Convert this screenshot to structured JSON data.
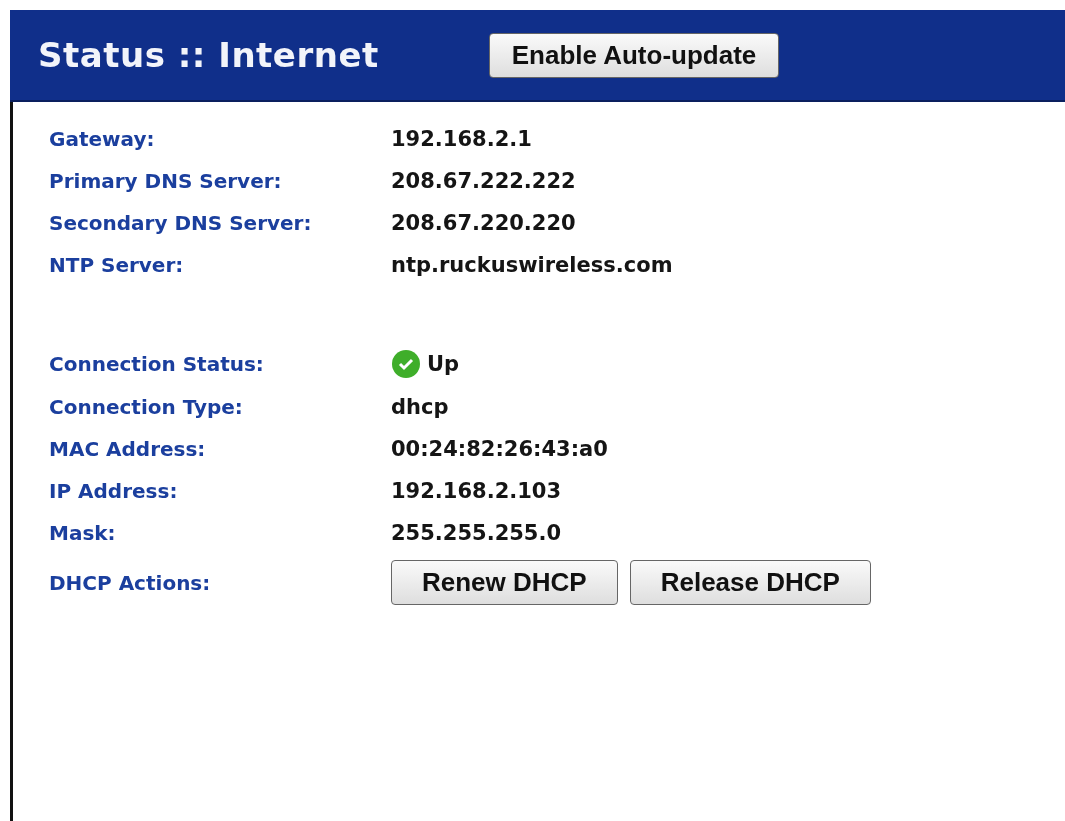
{
  "header": {
    "title": "Status :: Internet",
    "button": "Enable Auto-update"
  },
  "groups": [
    {
      "rows": [
        {
          "kind": "text",
          "label": "Gateway:",
          "value": "192.168.2.1"
        },
        {
          "kind": "text",
          "label": "Primary DNS Server:",
          "value": "208.67.222.222"
        },
        {
          "kind": "text",
          "label": "Secondary DNS Server:",
          "value": "208.67.220.220"
        },
        {
          "kind": "text",
          "label": "NTP Server:",
          "value": "ntp.ruckuswireless.com"
        }
      ]
    },
    {
      "rows": [
        {
          "kind": "status",
          "label": "Connection Status:",
          "value": "Up",
          "connected": true
        },
        {
          "kind": "text",
          "label": "Connection Type:",
          "value": "dhcp"
        },
        {
          "kind": "text",
          "label": "MAC Address:",
          "value": "00:24:82:26:43:a0"
        },
        {
          "kind": "text",
          "label": "IP Address:",
          "value": "192.168.2.103"
        },
        {
          "kind": "text",
          "label": "Mask:",
          "value": "255.255.255.0"
        },
        {
          "kind": "buttons",
          "label": "DHCP Actions:",
          "buttons": [
            "Renew DHCP",
            "Release DHCP"
          ]
        }
      ]
    }
  ]
}
